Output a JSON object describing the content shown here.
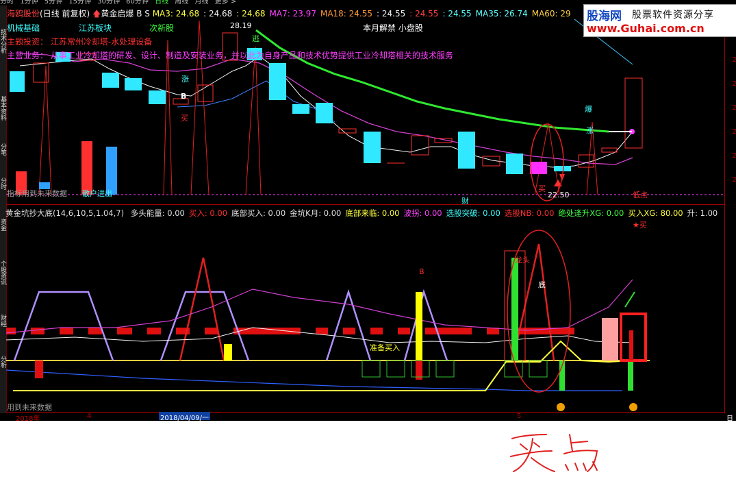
{
  "period_tabs": [
    "分时",
    "1分钟",
    "5分钟",
    "15分钟",
    "30分钟",
    "60分钟",
    "日线",
    "周线",
    "月线",
    "更多 >"
  ],
  "side_tabs": [
    "技术分析",
    "基本资料",
    "分笔",
    "分时",
    "资金",
    "个股资讯",
    "财经",
    "分析"
  ],
  "header": {
    "stock_name": "海鸥股份",
    "mode": "(日线 前复权)",
    "indicator_name": "黄金启爆 B S",
    "ma_values": [
      {
        "label": "MA3: 24.68",
        "color": "#ffff40"
      },
      {
        "label": ": 24.68",
        "color": "#f0f0f0"
      },
      {
        "label": ": 24.68",
        "color": "#ffff40"
      },
      {
        "label": "MA7: 23.97",
        "color": "#ff40ff"
      },
      {
        "label": "MA18: 24.55",
        "color": "#ff9a3a"
      },
      {
        "label": ": 24.55",
        "color": "#f0f0f0"
      },
      {
        "label": ": 24.55",
        "color": "#ff4040"
      },
      {
        "label": ": 24.55",
        "color": "#60ffff"
      },
      {
        "label": "MA35: 26.74",
        "color": "#60ffff"
      },
      {
        "label": "MA60: 29",
        "color": "#ffd040"
      }
    ]
  },
  "logo": {
    "name": "股海网",
    "slogan": "股票软件资源分享",
    "url": "www.Guhai.com.cn"
  },
  "main_chart": {
    "tags": {
      "tag1": "机械基础",
      "tag2": "江苏板块",
      "tag3": "次新股",
      "tag4": "本月解禁 小盘股"
    },
    "topic": "主题投资：   江苏常州冷却塔-水处理设备",
    "business": "主营业务：    从事工业冷却塔的研发、设计、制造及安装业务，并以此为自身产品和技术优势提供工业冷却塔相关的技术服务",
    "high_label": "28.19",
    "low_label": "22.50",
    "note_future": "指标用到未来数据",
    "note_retail": "散户进出",
    "note_cai": "财",
    "note_lowpoint": "低点",
    "sig_zhang1": "涨",
    "sig_b": "B",
    "sig_mai": "买",
    "sig_tui": "逃",
    "sig_bao": "爆",
    "sig_zhang2": "涨",
    "sig_mai2": "买",
    "right_ticks": [
      "2",
      "2",
      "2",
      "2",
      "2",
      "2"
    ],
    "bar_colors": {
      "up": "#ff3030",
      "down": "#30e8ff",
      "mag": "#ff30ff"
    }
  },
  "indicator_bar": {
    "title": "黄金坑抄大底(14,6,10,5,1.04,7)",
    "items": [
      {
        "label": "多头能量: 0.00",
        "color": "#e0e0e0"
      },
      {
        "label": "买入: 0.00",
        "color": "#ff3030"
      },
      {
        "label": "底部买入: 0.00",
        "color": "#e0e0e0"
      },
      {
        "label": "金坑K月: 0.00",
        "color": "#e0e0e0"
      },
      {
        "label": "底部来临: 0.00",
        "color": "#ffff40"
      },
      {
        "label": "波拐: 0.00",
        "color": "#ff40ff"
      },
      {
        "label": "选股突破: 0.00",
        "color": "#40ffff"
      },
      {
        "label": "选股NB: 0.00",
        "color": "#ff3030"
      },
      {
        "label": "绝处逢升XG: 0.00",
        "color": "#40ff40"
      },
      {
        "label": "买入XG: 80.00",
        "color": "#ffff40"
      },
      {
        "label": "升: 1.00",
        "color": "#e0e0e0"
      }
    ]
  },
  "sub_chart": {
    "star_buy": "★买",
    "label_b": "B",
    "label_dragon": "龙头",
    "label_di": "底",
    "label_prepare": "准备买入",
    "note_future2": "用到未来数据"
  },
  "time_axis": {
    "year": "2018年",
    "m4": "4",
    "mid_date": "2018/04/09/一",
    "m5": "5",
    "ri": "日"
  },
  "handwriting": "买点"
}
